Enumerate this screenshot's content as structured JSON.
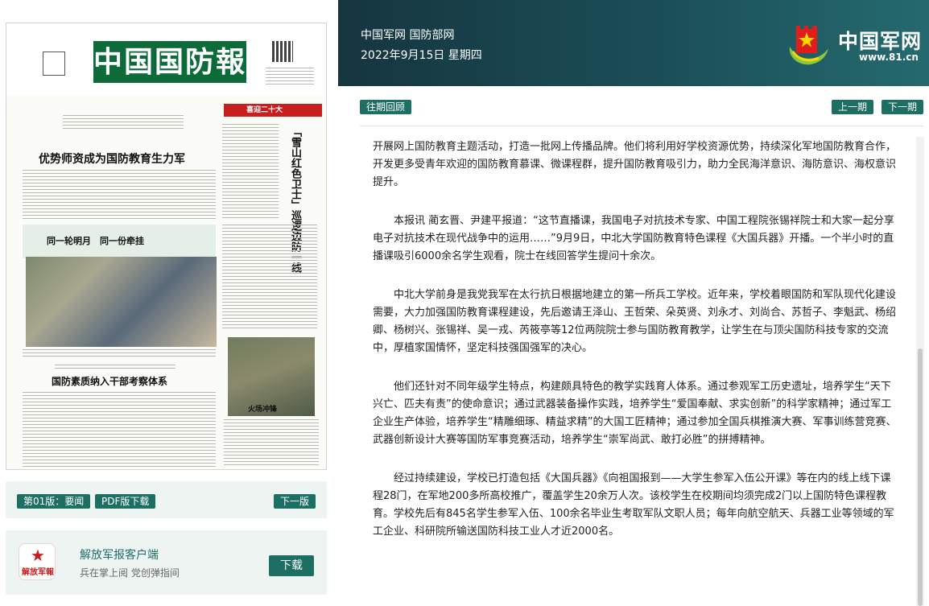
{
  "header": {
    "site_name": "中国军网 国防部网",
    "date": "2022年9月15日 星期四",
    "logo_text": "中国军网",
    "logo_url": "www.81.cn"
  },
  "newspaper": {
    "title": "中国国防報",
    "headline_main": "优势师资成为国防教育生力军",
    "red_bar": "喜迎二十大",
    "vertical_headline": "「雪山红色卫士」巡逻边防一线",
    "band_title": "同一轮明月　同一份牵挂",
    "photo_caption": "火场冲锋",
    "headline_bottom": "国防素质纳入干部考察体系"
  },
  "left_nav": {
    "edition_label": "第01版：要闻",
    "pdf_label": "PDF版下载",
    "next_edition": "下一版"
  },
  "app_promo": {
    "logo_text": "解放军報",
    "name": "解放军报客户端",
    "desc": "兵在掌上阅 党创弹指间",
    "download": "下载"
  },
  "nav": {
    "archive": "往期回顾",
    "prev_issue": "上一期",
    "next_issue": "下一期"
  },
  "article": {
    "paragraphs": [
      "开展网上国防教育主题活动，打造一批网上传播品牌。他们将利用好学校资源优势，持续深化军地国防教育合作，开发更多受青年欢迎的国防教育慕课、微课程群，提升国防教育吸引力，助力全民海洋意识、海防意识、海权意识提升。",
      "本报讯 蔺玄晋、尹建平报道：“这节直播课，我国电子对抗技术专家、中国工程院张锡祥院士和大家一起分享电子对抗技术在现代战争中的运用……”9月9日，中北大学国防教育特色课程《大国兵器》开播。一个半小时的直播课吸引6000余名学生观看，院士在线回答学生提问十余次。",
      "中北大学前身是我党我军在太行抗日根据地建立的第一所兵工学校。近年来，学校着眼国防和军队现代化建设需要，大力加强国防教育课程建设，先后邀请王泽山、王哲荣、朵英贤、刘永才、刘尚合、苏哲子、李魁武、杨绍卿、杨树兴、张锡祥、吴一戎、芮筱亭等12位两院院士参与国防教育教学，让学生在与顶尖国防科技专家的交流中，厚植家国情怀，坚定科技强国强军的决心。",
      "他们还针对不同年级学生特点，构建颇具特色的教学实践育人体系。通过参观军工历史遗址，培养学生“天下兴亡、匹夫有责”的使命意识；通过武器装备操作实践，培养学生“爱国奉献、求实创新”的科学家精神；通过军工企业生产体验，培养学生“精雕细琢、精益求精”的大国工匠精神；通过参加全国兵棋推演大赛、军事训练营竞赛、武器创新设计大赛等国防军事竞赛活动，培养学生“崇军尚武、敢打必胜”的拼搏精神。",
      "经过持续建设，学校已打造包括《大国兵器》《向祖国报到——大学生参军入伍公开课》等在内的线上线下课程28门，在军地200多所高校推广，覆盖学生20余万人次。该校学生在校期间均须完成2门以上国防特色课程教育。学校先后有845名学生参军入伍、100余名毕业生考取军队文职人员；每年向航空航天、兵器工业等领域的军工企业、科研院所输送国防科技工业人才近2000名。"
    ]
  },
  "colors": {
    "accent": "#1e6f63",
    "header_dark": "#16353f",
    "red": "#c81e1e"
  }
}
